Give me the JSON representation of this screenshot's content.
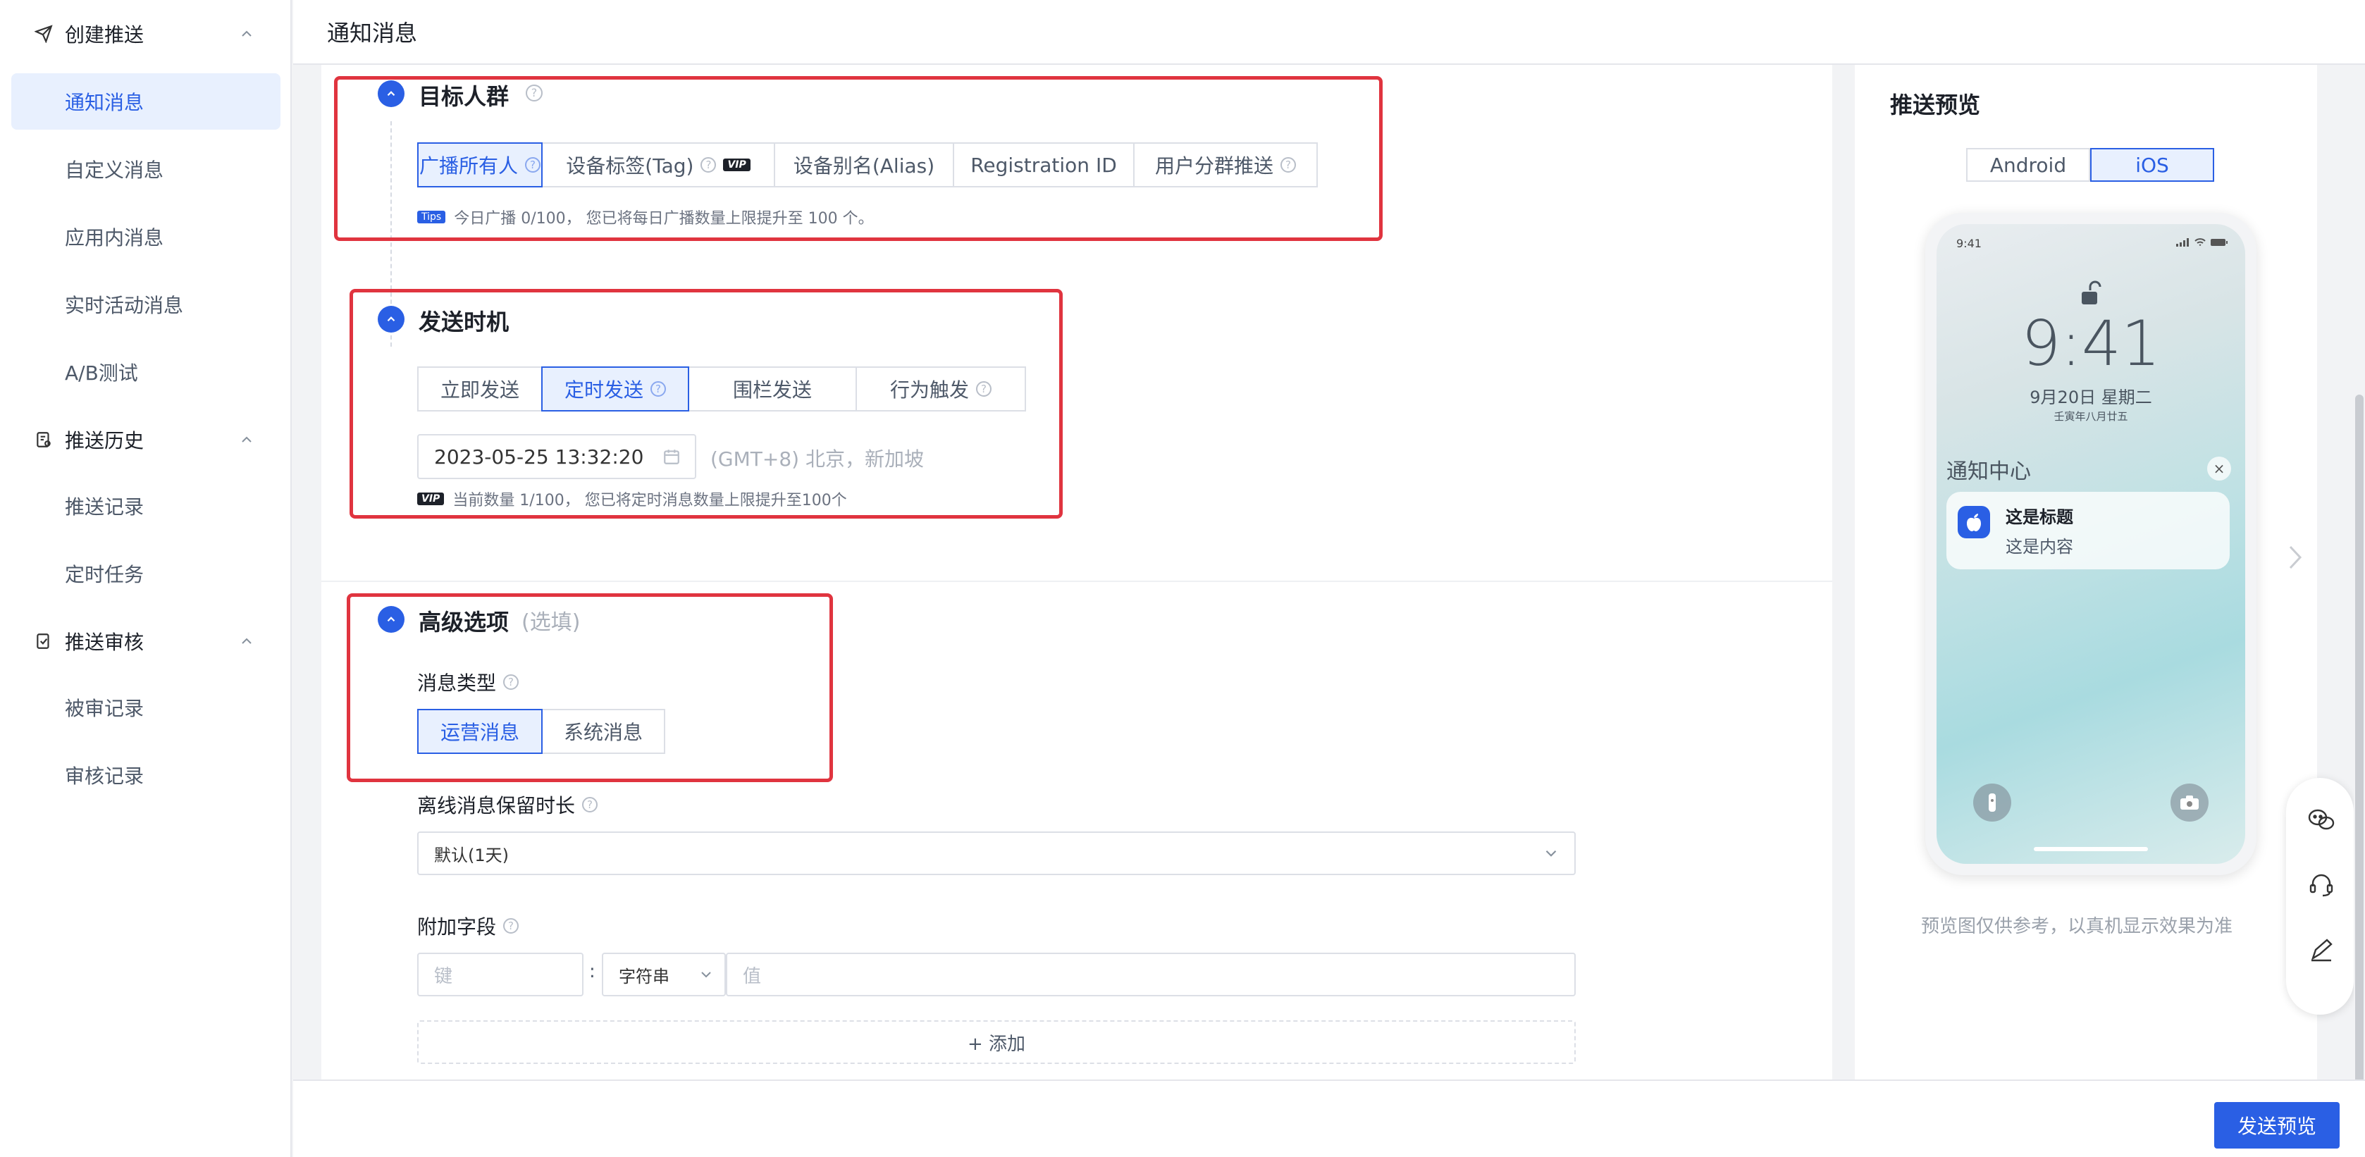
{
  "sidebar": {
    "groups": [
      {
        "label": "创建推送",
        "icon": "send-icon"
      },
      {
        "label": "推送历史",
        "icon": "history-icon"
      },
      {
        "label": "推送审核",
        "icon": "review-icon"
      }
    ],
    "items": [
      {
        "label": "通知消息",
        "active": true
      },
      {
        "label": "自定义消息"
      },
      {
        "label": "应用内消息"
      },
      {
        "label": "实时活动消息"
      },
      {
        "label": "A/B测试"
      },
      {
        "label": "推送记录"
      },
      {
        "label": "定时任务"
      },
      {
        "label": "被审记录"
      },
      {
        "label": "审核记录"
      }
    ]
  },
  "header": {
    "title": "通知消息"
  },
  "target": {
    "title": "目标人群",
    "options": [
      "广播所有人",
      "设备标签(Tag)",
      "设备别名(Alias)",
      "Registration ID",
      "用户分群推送"
    ],
    "selected": "广播所有人",
    "vip_badge": "VIP",
    "tips_badge": "Tips",
    "note": "今日广播 0/100，  您已将每日广播数量上限提升至 100 个。"
  },
  "timing": {
    "title": "发送时机",
    "options": [
      "立即发送",
      "定时发送",
      "围栏发送",
      "行为触发"
    ],
    "selected": "定时发送",
    "datetime": "2023-05-25 13:32:20",
    "timezone": "(GMT+8) 北京，新加坡",
    "vip_badge": "VIP",
    "note": "当前数量 1/100，  您已将定时消息数量上限提升至100个"
  },
  "advanced": {
    "title": "高级选项",
    "subtitle": "(选填)",
    "msg_type_label": "消息类型",
    "msg_type_options": [
      "运营消息",
      "系统消息"
    ],
    "msg_type_selected": "运营消息",
    "offline_label": "离线消息保留时长",
    "offline_value": "默认(1天)",
    "extra_label": "附加字段",
    "key_placeholder": "键",
    "colon": ":",
    "type_value": "字符串",
    "value_placeholder": "值",
    "add_label": "+ 添加"
  },
  "preview": {
    "title": "推送预览",
    "tabs": [
      "Android",
      "iOS"
    ],
    "selected_tab": "iOS",
    "status_time": "9:41",
    "lock_time": "9:41",
    "date": "9月20日 星期二",
    "lunar": "壬寅年八月廿五",
    "nc_title": "通知中心",
    "close_glyph": "×",
    "notif_title": "这是标题",
    "notif_body": "这是内容",
    "note": "预览图仅供参考，以真机显示效果为准"
  },
  "footer": {
    "send_preview": "发送预览"
  },
  "colors": {
    "primary": "#2a5fe4",
    "highlight": "#e0343f"
  }
}
